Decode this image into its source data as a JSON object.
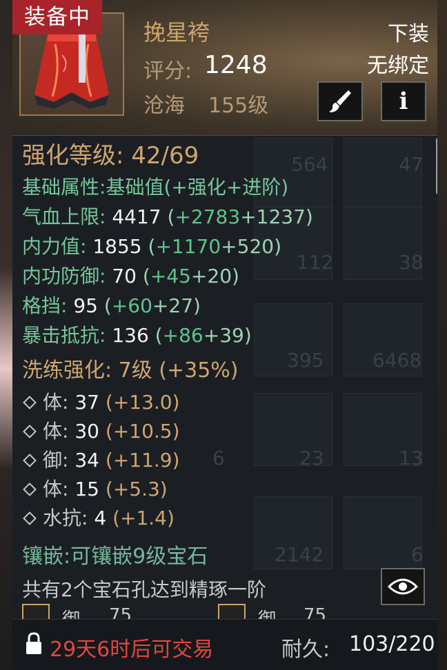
{
  "header": {
    "equipped_tag": "装备中",
    "item_name": "挽星袴",
    "score_label": "评分:",
    "score_value": "1248",
    "school": "沧海",
    "level": "155级",
    "slot": "下装",
    "bind_status": "无绑定",
    "brush_icon": "brush-icon",
    "info_icon": "info-icon"
  },
  "enhance": {
    "label": "强化等级:",
    "value": "42/69"
  },
  "base_attr_header": {
    "label": "基础属性:",
    "base": "基础值(",
    "plus1": "+强化",
    "plus2": "+进阶)"
  },
  "base_attrs": [
    {
      "name": "气血上限:",
      "value": "4417",
      "bonus1": "+2783",
      "bonus2": "+1237"
    },
    {
      "name": "内力值:",
      "value": "1855",
      "bonus1": "+1170",
      "bonus2": "+520"
    },
    {
      "name": "内功防御:",
      "value": "70",
      "bonus1": "+45",
      "bonus2": "+20"
    },
    {
      "name": "格挡:",
      "value": "95",
      "bonus1": "+60",
      "bonus2": "+27"
    },
    {
      "name": "暴击抵抗:",
      "value": "136",
      "bonus1": "+86",
      "bonus2": "+39"
    }
  ],
  "refine": {
    "label": "洗练强化:",
    "value": "7级 (+35%)"
  },
  "refine_attrs": [
    {
      "name": "体:",
      "value": "37",
      "bonus": "(+13.0)"
    },
    {
      "name": "体:",
      "value": "30",
      "bonus": "(+10.5)"
    },
    {
      "name": "御:",
      "value": "34",
      "bonus": "(+11.9)"
    },
    {
      "name": "体:",
      "value": "15",
      "bonus": "(+5.3)"
    },
    {
      "name": "水抗:",
      "value": "4",
      "bonus": "(+1.4)"
    }
  ],
  "inlay": {
    "title": "镶嵌:可镶嵌9级宝石",
    "desc": "共有2个宝石孔达到精琢一阶",
    "eye_icon": "eye-icon"
  },
  "gems": [
    {
      "name": "御",
      "value": "75"
    },
    {
      "name": "御",
      "value": "75"
    }
  ],
  "footer": {
    "lock_icon": "lock-icon",
    "trade_text": "29天6时后可交易",
    "durability_label": "耐久:",
    "durability_value": "103/220"
  },
  "background_grid": [
    "564",
    "47",
    "112",
    "38",
    "395",
    "6468",
    "6",
    "23",
    "13",
    "2142",
    "6"
  ],
  "colors": {
    "tag_red": "#a9242a",
    "gold": "#cfa56e",
    "green": "#75c79a",
    "bonus_green": "#5ec58c",
    "trade_red": "#e0473e"
  }
}
